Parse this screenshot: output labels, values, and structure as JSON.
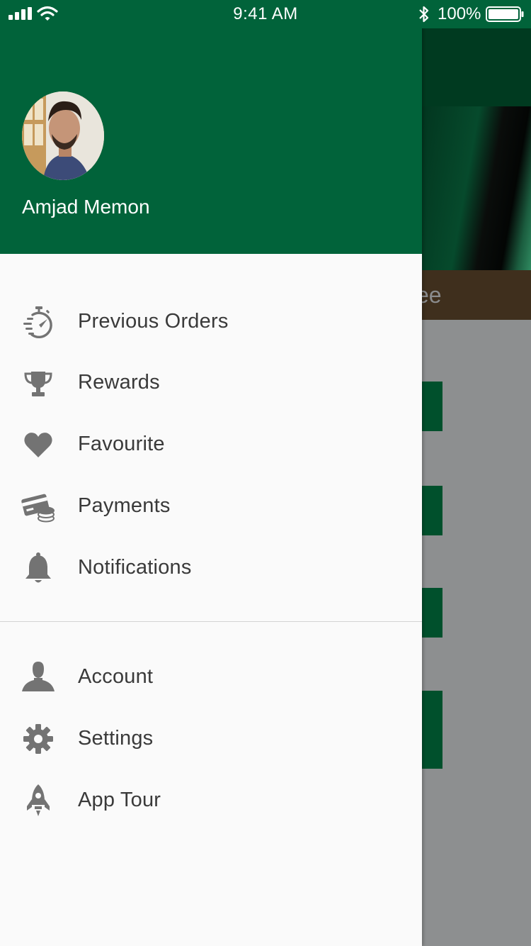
{
  "status_bar": {
    "time": "9:41 AM",
    "battery": "100%",
    "icons": [
      "signal-icon",
      "wifi-icon",
      "bluetooth-icon",
      "battery-icon"
    ]
  },
  "drawer": {
    "user": {
      "name": "Amjad Memon"
    },
    "menu": [
      {
        "label": "Previous Orders",
        "icon": "stopwatch-icon"
      },
      {
        "label": "Rewards",
        "icon": "trophy-icon"
      },
      {
        "label": "Favourite",
        "icon": "heart-icon"
      },
      {
        "label": "Payments",
        "icon": "card-coins-icon"
      },
      {
        "label": "Notifications",
        "icon": "bell-icon"
      }
    ],
    "secondary_menu": [
      {
        "label": "Account",
        "icon": "person-icon"
      },
      {
        "label": "Settings",
        "icon": "gear-icon"
      },
      {
        "label": "App Tour",
        "icon": "rocket-icon"
      }
    ]
  },
  "background": {
    "title_fragment": "ee"
  },
  "colors": {
    "header": "#01633a",
    "drawer_bg": "#fafafa",
    "icon": "#737373",
    "label": "#3a3a3a"
  }
}
